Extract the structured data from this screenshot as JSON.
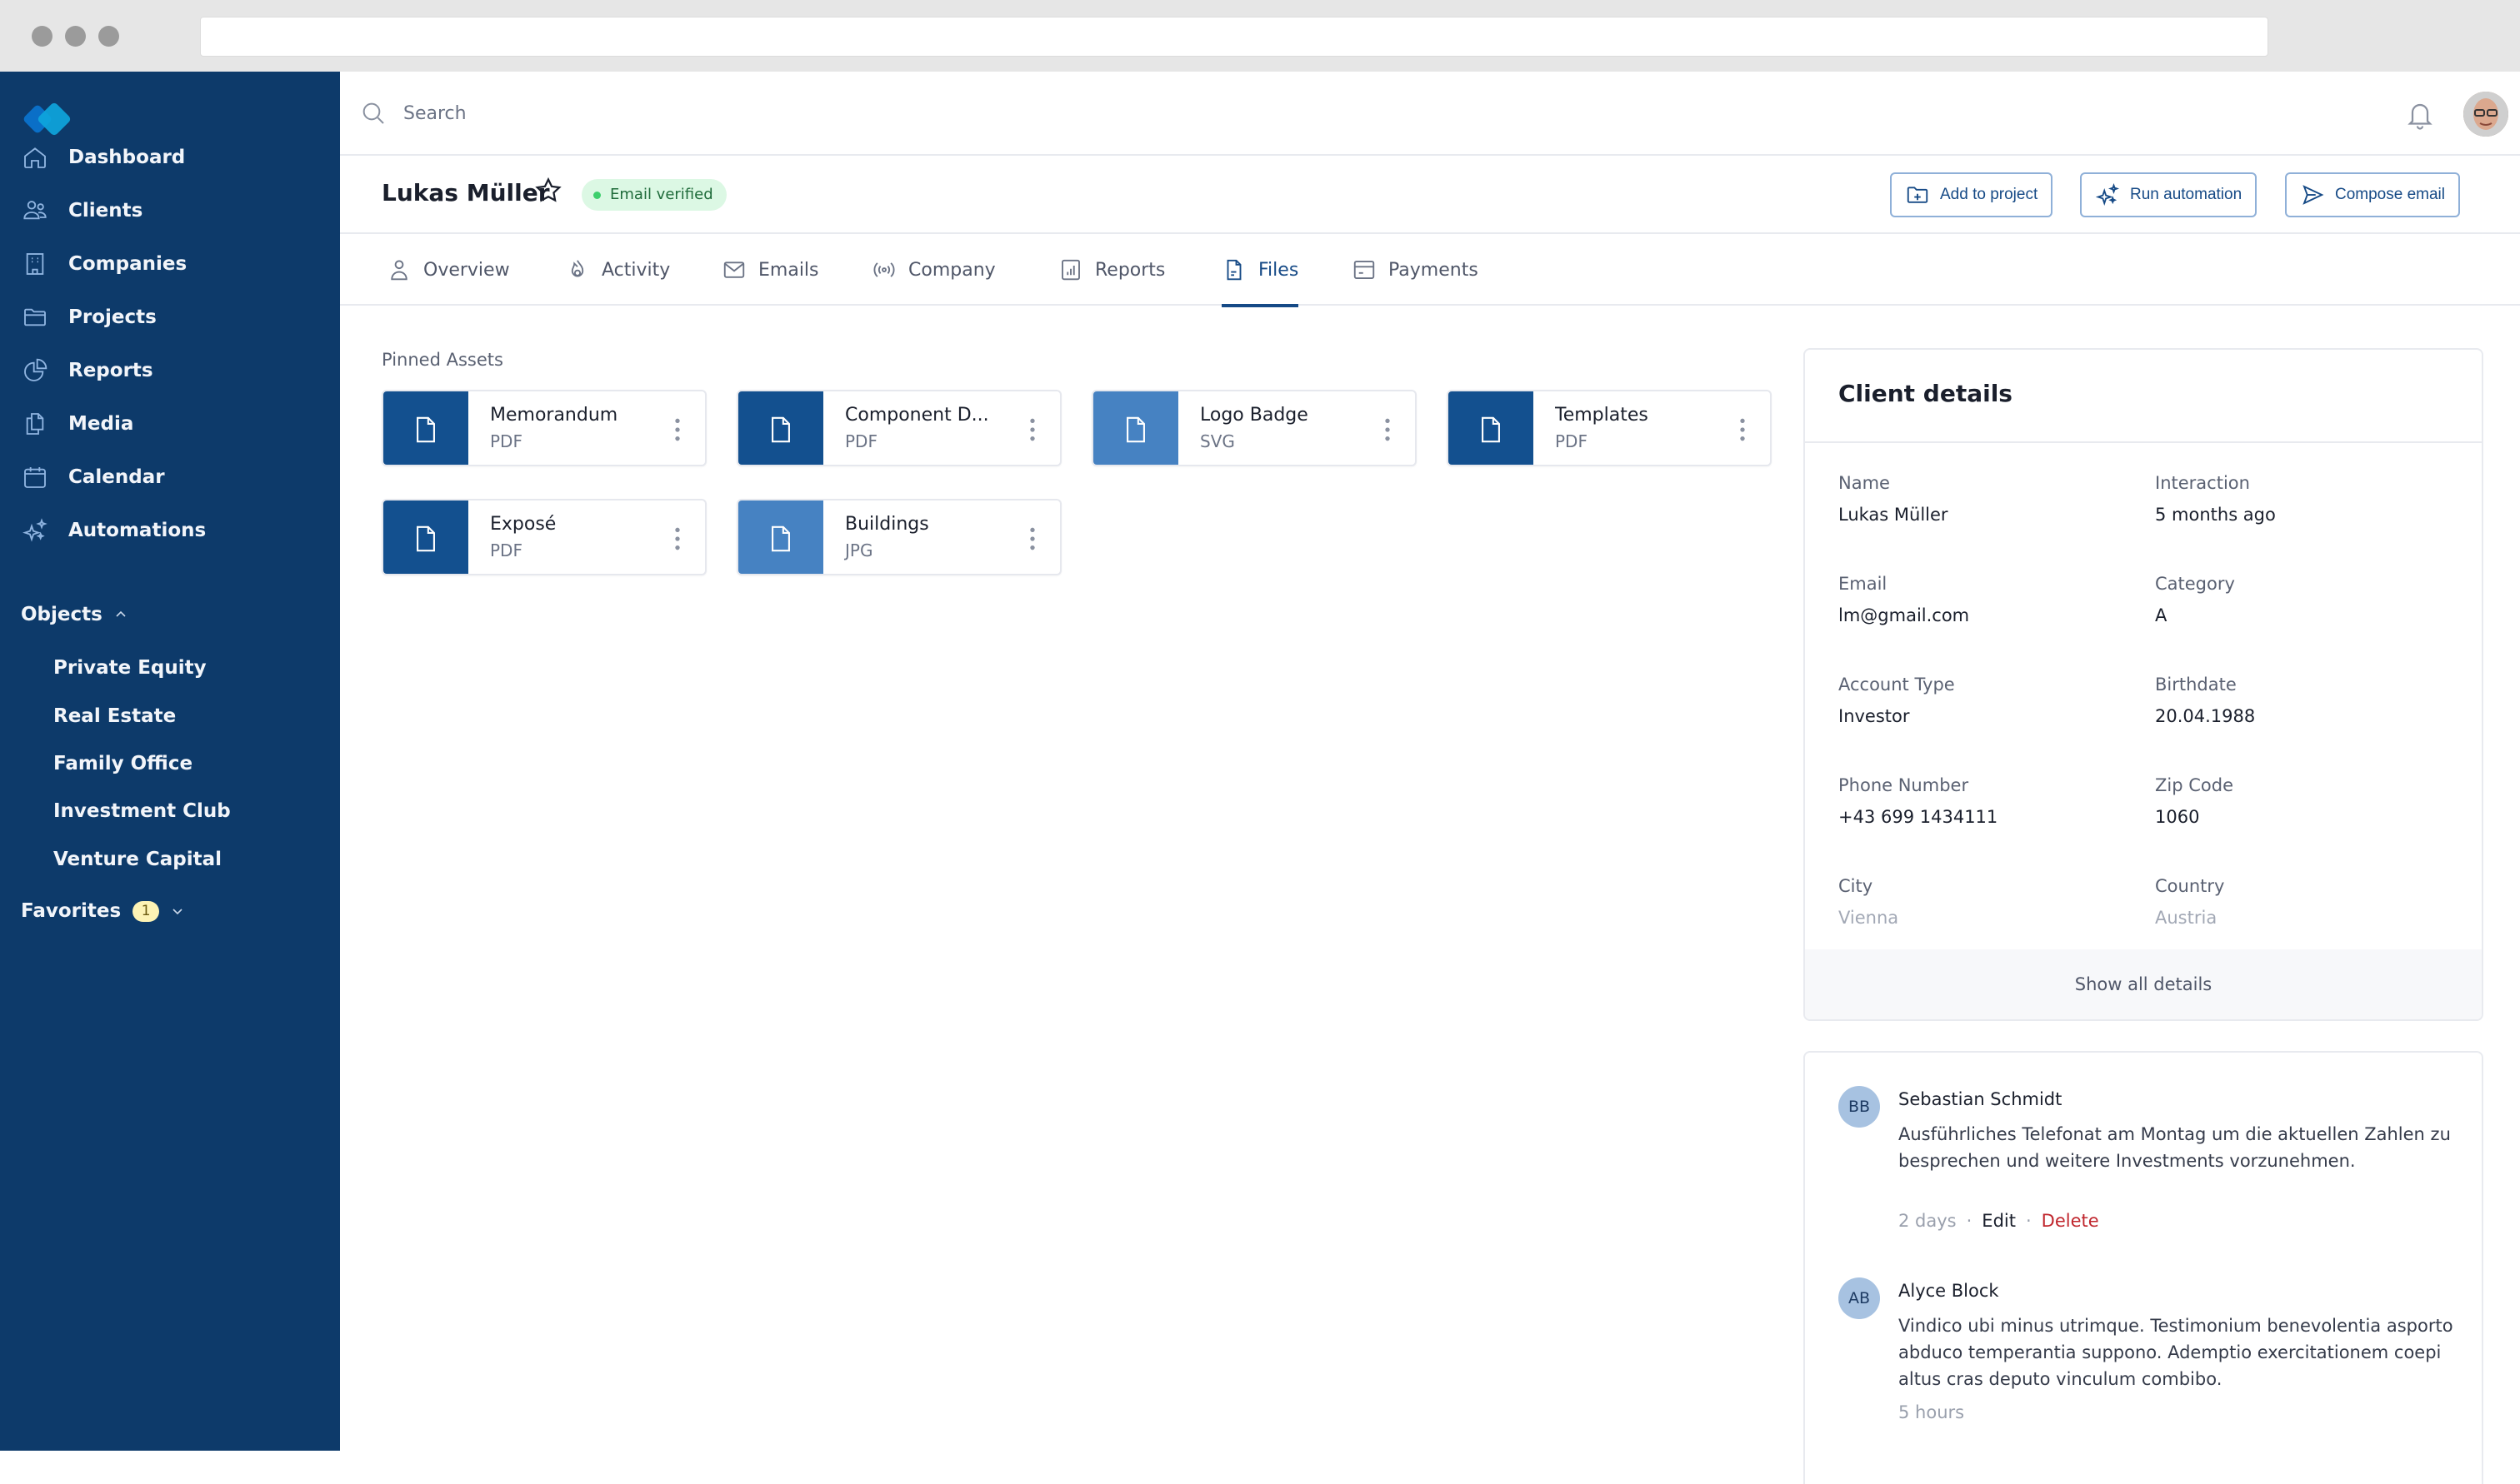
{
  "browser": {
    "url": ""
  },
  "sidebar": {
    "logo": "app-logo",
    "items": [
      {
        "label": "Dashboard",
        "icon": "home-icon"
      },
      {
        "label": "Clients",
        "icon": "users-icon"
      },
      {
        "label": "Companies",
        "icon": "building-icon"
      },
      {
        "label": "Projects",
        "icon": "folder-icon"
      },
      {
        "label": "Reports",
        "icon": "pie-chart-icon"
      },
      {
        "label": "Media",
        "icon": "copy-icon"
      },
      {
        "label": "Calendar",
        "icon": "calendar-icon"
      },
      {
        "label": "Automations",
        "icon": "sparkles-icon"
      }
    ],
    "objects": {
      "label": "Objects",
      "expanded": true,
      "items": [
        "Private Equity",
        "Real Estate",
        "Family Office",
        "Investment Club",
        "Venture Capital"
      ]
    },
    "favorites": {
      "label": "Favorites",
      "count": "1"
    }
  },
  "topbar": {
    "search_placeholder": "Search"
  },
  "profile": {
    "name": "Lukas Müller",
    "verified_label": "Email verified",
    "actions": [
      {
        "label": "Add to project",
        "icon": "folder-plus-icon"
      },
      {
        "label": "Run automation",
        "icon": "sparkles-icon"
      },
      {
        "label": "Compose email",
        "icon": "send-icon"
      }
    ]
  },
  "tabs": [
    {
      "label": "Overview",
      "icon": "user-icon"
    },
    {
      "label": "Activity",
      "icon": "flame-icon"
    },
    {
      "label": "Emails",
      "icon": "mail-icon"
    },
    {
      "label": "Company",
      "icon": "broadcast-icon"
    },
    {
      "label": "Reports",
      "icon": "bar-chart-icon"
    },
    {
      "label": "Files",
      "icon": "file-icon",
      "active": true
    },
    {
      "label": "Payments",
      "icon": "credit-card-icon"
    }
  ],
  "pinned": {
    "title": "Pinned Assets",
    "assets": [
      {
        "name": "Memorandum",
        "type": "PDF",
        "color": "#13508f"
      },
      {
        "name": "Component D...",
        "type": "PDF",
        "color": "#13508f"
      },
      {
        "name": "Logo Badge",
        "type": "SVG",
        "color": "#4682c2"
      },
      {
        "name": "Templates",
        "type": "PDF",
        "color": "#13508f"
      },
      {
        "name": "Exposé",
        "type": "PDF",
        "color": "#13508f"
      },
      {
        "name": "Buildings",
        "type": "JPG",
        "color": "#4682c2"
      }
    ]
  },
  "client_details": {
    "title": "Client details",
    "fields": [
      {
        "label": "Name",
        "value": "Lukas Müller"
      },
      {
        "label": "Interaction",
        "value": "5 months ago"
      },
      {
        "label": "Email",
        "value": "lm@gmail.com"
      },
      {
        "label": "Category",
        "value": "A"
      },
      {
        "label": "Account Type",
        "value": "Investor"
      },
      {
        "label": "Birthdate",
        "value": "20.04.1988"
      },
      {
        "label": "Phone Number",
        "value": "+43 699 1434111"
      },
      {
        "label": "Zip Code",
        "value": "1060"
      },
      {
        "label": "City",
        "value": "Vienna"
      },
      {
        "label": "Country",
        "value": "Austria"
      }
    ],
    "show_all": "Show all details"
  },
  "comments": [
    {
      "initials": "BB",
      "author": "Sebastian Schmidt",
      "text": "Ausführliches Telefonat am Montag um die aktuellen Zahlen zu besprechen und weitere Investments vorzunehmen.",
      "time": "2 days",
      "edit": "Edit",
      "delete": "Delete"
    },
    {
      "initials": "AB",
      "author": "Alyce Block",
      "text": "Vindico ubi minus utrimque. Testimonium benevolentia asporto abduco temperantia suppono. Ademptio exercitationem coepi altus cras deputo vinculum combibo.",
      "time": "5 hours"
    }
  ],
  "colors": {
    "sidebar_bg": "#0d3a6a",
    "accent": "#164a86",
    "verified_bg": "#dcf8e4",
    "delete": "#c0262d",
    "favorites_badge": "#fdf3b5"
  }
}
